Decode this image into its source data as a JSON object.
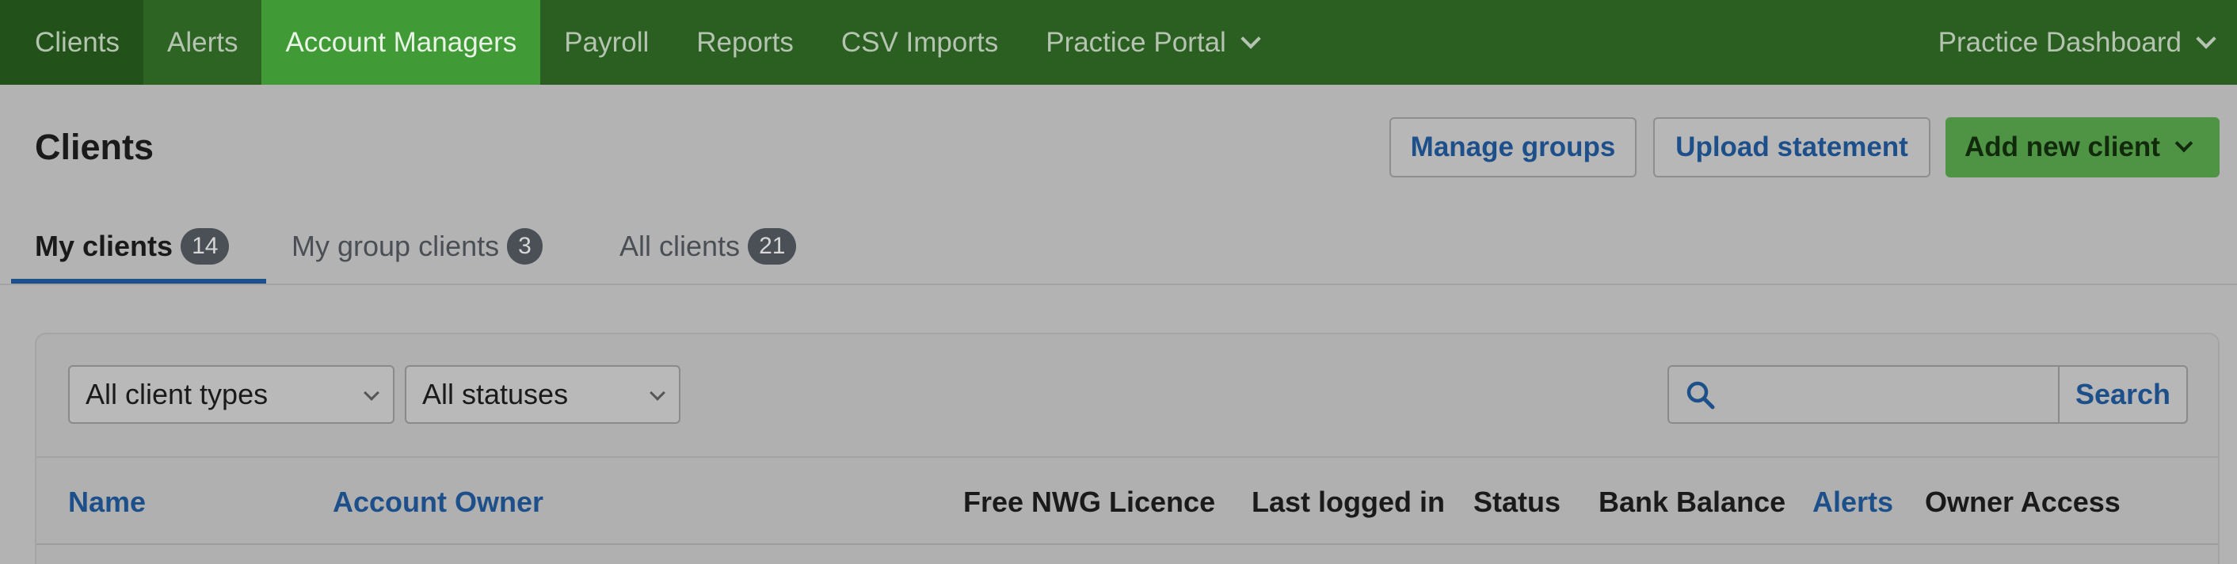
{
  "topnav": {
    "items": [
      {
        "label": "Clients"
      },
      {
        "label": "Alerts"
      },
      {
        "label": "Account Managers"
      },
      {
        "label": "Payroll"
      },
      {
        "label": "Reports"
      },
      {
        "label": "CSV Imports"
      },
      {
        "label": "Practice Portal"
      }
    ],
    "right_label": "Practice Dashboard"
  },
  "header": {
    "title": "Clients",
    "manage_groups": "Manage groups",
    "upload_statement": "Upload statement",
    "add_new_client": "Add new client"
  },
  "tabs": [
    {
      "label": "My clients",
      "count": "14"
    },
    {
      "label": "My group clients",
      "count": "3"
    },
    {
      "label": "All clients",
      "count": "21"
    }
  ],
  "filters": {
    "client_type": "All client types",
    "status": "All statuses",
    "search_placeholder": "",
    "search_button": "Search"
  },
  "table": {
    "columns": [
      {
        "label": "Name"
      },
      {
        "label": "Account Owner"
      },
      {
        "label": "Free NWG Licence"
      },
      {
        "label": "Last logged in"
      },
      {
        "label": "Status"
      },
      {
        "label": "Bank Balance"
      },
      {
        "label": "Alerts"
      },
      {
        "label": "Owner Access"
      }
    ]
  },
  "colors": {
    "nav_bg": "#2b5e21",
    "nav_active": "#409a35",
    "link_blue": "#1d4f8a",
    "primary_button": "#4f9444"
  }
}
